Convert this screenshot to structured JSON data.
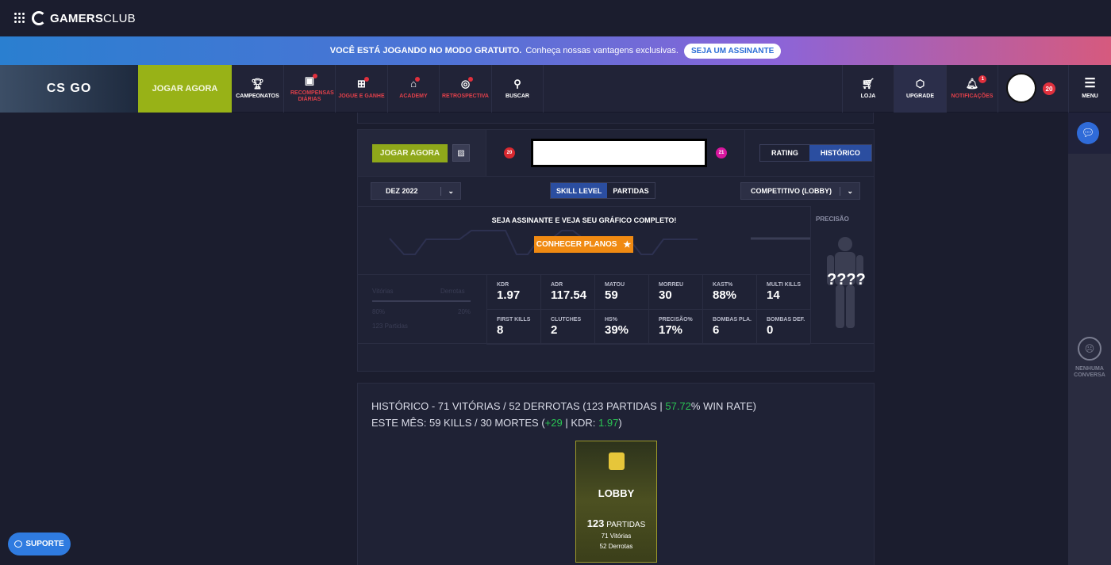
{
  "topbar": {
    "brand_bold": "GAMERS",
    "brand_light": "CLUB"
  },
  "promo": {
    "bold": "VOCÊ ESTÁ JOGANDO NO MODO GRATUITO.",
    "text": "Conheça nossas vantagens exclusivas.",
    "button": "SEJA UM ASSINANTE"
  },
  "nav": {
    "game": "CS GO",
    "play": "JOGAR AGORA",
    "items": [
      {
        "label": "CAMPEONATOS",
        "icon": "trophy-icon",
        "alert": false
      },
      {
        "label": "RECOMPENSAS DIÁRIAS",
        "icon": "calendar-icon",
        "alert": true
      },
      {
        "label": "JOGUE E GANHE",
        "icon": "gift-icon",
        "alert": true
      },
      {
        "label": "ACADEMY",
        "icon": "graduation-cap-icon",
        "alert": true
      },
      {
        "label": "RETROSPECTIVA",
        "icon": "retro-icon",
        "alert": true
      },
      {
        "label": "BUSCAR",
        "icon": "search-icon",
        "alert": false
      }
    ],
    "right": [
      {
        "label": "LOJA",
        "icon": "cart-icon"
      },
      {
        "label": "UPGRADE",
        "icon": "star-shield-icon"
      },
      {
        "label": "NOTIFICAÇÕES",
        "icon": "bell-icon",
        "count": "1"
      }
    ],
    "level": "20",
    "menu": "MENU"
  },
  "profile": {
    "play": "JOGAR AGORA",
    "level_left": "20",
    "level_right": "21",
    "tabs": [
      "RATING",
      "HISTÓRICO"
    ],
    "active_tab": "HISTÓRICO"
  },
  "filters": {
    "month": "DEZ 2022",
    "modes": [
      "SKILL LEVEL",
      "PARTIDAS"
    ],
    "active_mode": "SKILL LEVEL",
    "queue": "COMPETITIVO (LOBBY)"
  },
  "chart": {
    "headline": "SEJA ASSINANTE E VEJA SEU GRÁFICO COMPLETO!",
    "cta": "CONHECER PLANOS"
  },
  "precision": {
    "label": "PRECISÃO",
    "value": "????"
  },
  "winloss": {
    "vitorias": "Vitórias",
    "derrotas": "Derrotas",
    "pct_left": "80%",
    "pct_right": "20%",
    "partidas": "123 Partidas"
  },
  "stats": [
    {
      "k": "KDR",
      "v": "1.97"
    },
    {
      "k": "ADR",
      "v": "117.54"
    },
    {
      "k": "MATOU",
      "v": "59"
    },
    {
      "k": "MORREU",
      "v": "30"
    },
    {
      "k": "KAST%",
      "v": "88%"
    },
    {
      "k": "MULTI KILLS",
      "v": "14"
    },
    {
      "k": "FIRST KILLS",
      "v": "8"
    },
    {
      "k": "CLUTCHES",
      "v": "2"
    },
    {
      "k": "HS%",
      "v": "39%"
    },
    {
      "k": "PRECISÃO%",
      "v": "17%"
    },
    {
      "k": "BOMBAS PLA.",
      "v": "6"
    },
    {
      "k": "BOMBAS DEF.",
      "v": "0"
    }
  ],
  "history": {
    "line1_a": "HISTÓRICO - 71 VITÓRIAS / 52 DERROTAS (123 PARTIDAS | ",
    "line1_rate": "57.72",
    "line1_b": "% WIN RATE)",
    "line2_a": "ESTE MÊS: 59 KILLS / 30 MORTES (",
    "line2_diff": "+29",
    "line2_b": " | KDR: ",
    "line2_kdr": "1.97",
    "line2_c": ")"
  },
  "lobby": {
    "title": "LOBBY",
    "count": "123",
    "count_label": "PARTIDAS",
    "wins": "71 Vitórias",
    "losses": "52 Derrotas"
  },
  "rail": {
    "empty": "NENHUMA CONVERSA"
  },
  "support": "SUPORTE"
}
